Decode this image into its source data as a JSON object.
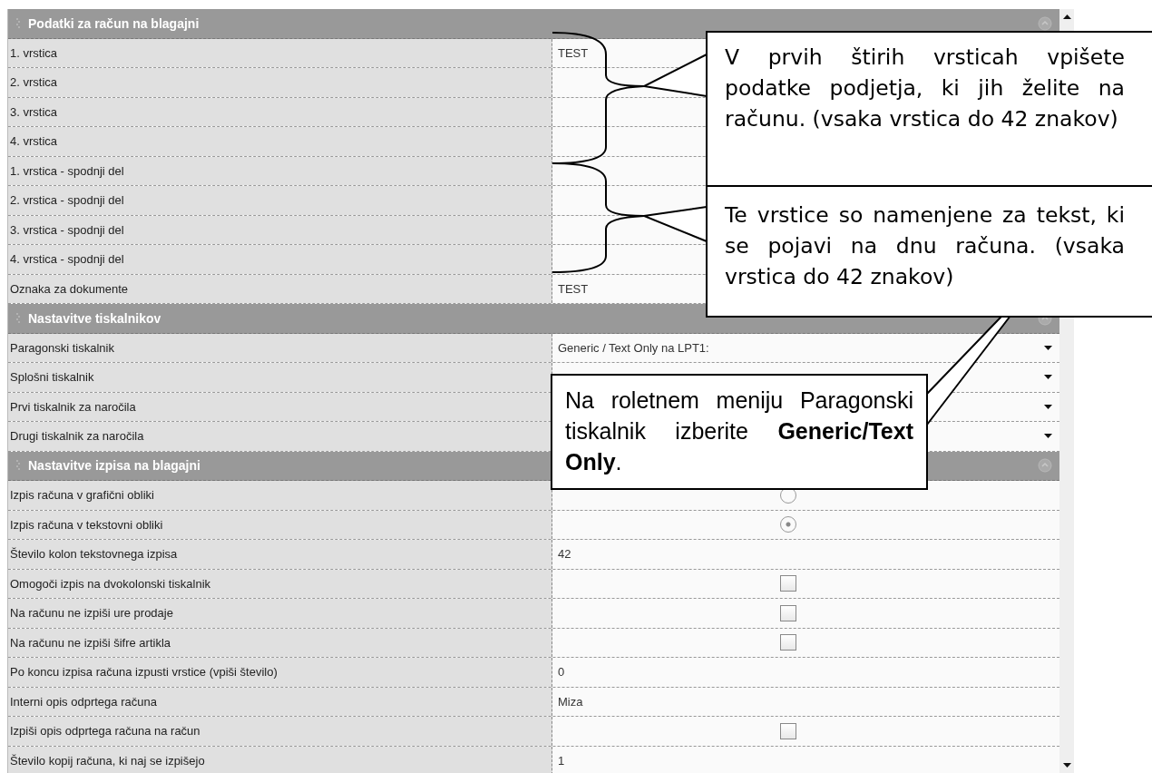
{
  "sections": [
    {
      "title": "Podatki za račun na blagajni",
      "rows": [
        {
          "label": "1. vrstica",
          "kind": "text",
          "value": "TEST"
        },
        {
          "label": "2. vrstica",
          "kind": "text"
        },
        {
          "label": "3. vrstica",
          "kind": "text"
        },
        {
          "label": "4. vrstica",
          "kind": "text"
        },
        {
          "label": "1. vrstica - spodnji del",
          "kind": "text"
        },
        {
          "label": "2. vrstica - spodnji del",
          "kind": "text"
        },
        {
          "label": "3. vrstica - spodnji del",
          "kind": "text"
        },
        {
          "label": "4. vrstica - spodnji del",
          "kind": "text"
        },
        {
          "label": "Oznaka za dokumente",
          "kind": "text",
          "value": "TEST"
        }
      ]
    },
    {
      "title": "Nastavitve tiskalnikov",
      "rows": [
        {
          "label": "Paragonski tiskalnik",
          "kind": "dropdown",
          "value": "Generic / Text Only na LPT1:"
        },
        {
          "label": "Splošni tiskalnik",
          "kind": "dropdown"
        },
        {
          "label": "Prvi tiskalnik za naročila",
          "kind": "dropdown"
        },
        {
          "label": "Drugi tiskalnik za naročila",
          "kind": "dropdown"
        }
      ]
    },
    {
      "title": "Nastavitve izpisa na blagajni",
      "rows": [
        {
          "label": "Izpis računa v grafični obliki",
          "kind": "radio",
          "selected": false
        },
        {
          "label": "Izpis računa v tekstovni obliki",
          "kind": "radio",
          "selected": true
        },
        {
          "label": "Število kolon tekstovnega izpisa",
          "kind": "text",
          "value": "42"
        },
        {
          "label": "Omogoči izpis na dvokolonski tiskalnik",
          "kind": "checkbox",
          "checked": false
        },
        {
          "label": "Na računu ne izpiši ure prodaje",
          "kind": "checkbox",
          "checked": false
        },
        {
          "label": "Na računu ne izpiši šifre artikla",
          "kind": "checkbox",
          "checked": false
        },
        {
          "label": "Po koncu izpisa računa izpusti vrstice (vpiši število)",
          "kind": "text",
          "value": "0"
        },
        {
          "label": "Interni opis odprtega računa",
          "kind": "text",
          "value": "Miza"
        },
        {
          "label": "Izpiši opis odprtega računa na račun",
          "kind": "checkbox",
          "checked": false
        },
        {
          "label": "Število kopij računa, ki naj se izpišejo",
          "kind": "text",
          "value": "1"
        }
      ]
    }
  ],
  "callouts": [
    "V prvih štirih vrsticah vpišete podatke podjetja, ki jih želite na računu. (vsaka vrstica do 42 znakov)",
    "Te vrstice so namenjene za tekst, ki se pojavi na dnu računa. (vsaka vrstica do 42 znakov)",
    "Na roletnem meniju Paragonski tiskalnik izberite **Generic/Text Only**."
  ]
}
